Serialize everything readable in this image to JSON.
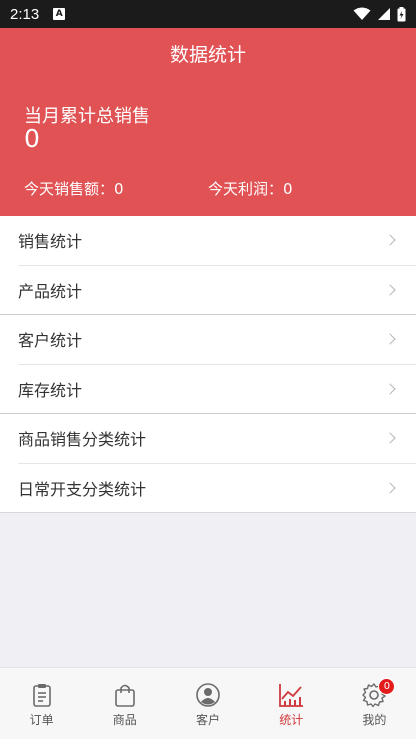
{
  "status_bar": {
    "time": "2:13",
    "notification_glyph": "A"
  },
  "header": {
    "title": "数据统计",
    "total_label": "当月累计总销售",
    "total_value": "0",
    "today_sales": "今天销售额：0",
    "today_profit": "今天利润：0",
    "color": "#e05254"
  },
  "menu": {
    "items": [
      {
        "label": "销售统计"
      },
      {
        "label": "产品统计"
      },
      {
        "label": "客户统计"
      },
      {
        "label": "库存统计"
      },
      {
        "label": "商品销售分类统计"
      },
      {
        "label": "日常开支分类统计"
      }
    ]
  },
  "tabbar": {
    "tabs": [
      {
        "label": "订单",
        "icon": "clipboard-icon"
      },
      {
        "label": "商品",
        "icon": "shopping-bag-icon"
      },
      {
        "label": "客户",
        "icon": "user-icon"
      },
      {
        "label": "统计",
        "icon": "chart-icon",
        "active": true
      },
      {
        "label": "我的",
        "icon": "gear-icon",
        "badge": "0"
      }
    ],
    "active_color": "#d0393d"
  }
}
